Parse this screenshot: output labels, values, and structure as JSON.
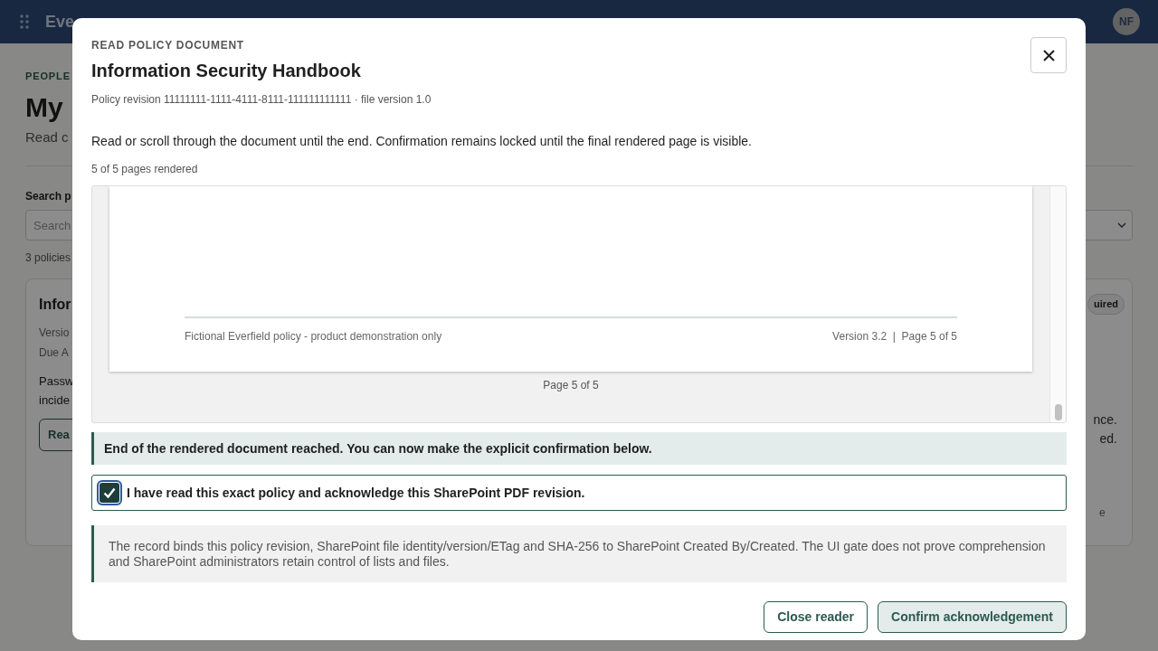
{
  "background": {
    "app_name": "Eve",
    "avatar": "NF",
    "eyebrow": "PEOPLE",
    "heading": "My",
    "subtitle": "Read c",
    "search_label": "Search p",
    "search_placeholder": "Search",
    "count": "3 policies",
    "card": {
      "title": "Infor",
      "badge": "uired",
      "meta": [
        "Versio",
        "Due A"
      ],
      "body": [
        "Passw",
        "incide"
      ],
      "button": "Rea",
      "right_lines": [
        "nce.",
        "ed."
      ],
      "right_footer": "e"
    }
  },
  "dialog": {
    "eyebrow": "READ POLICY DOCUMENT",
    "title": "Information Security Handbook",
    "subtitle": "Policy revision 11111111-1111-4111-8111-111111111111 · file version 1.0",
    "instruction": "Read or scroll through the document until the end. Confirmation remains locked until the final rendered page is visible.",
    "progress": "5 of 5 pages rendered",
    "viewer": {
      "footer_left": "Fictional Everfield policy - product demonstration only",
      "footer_right": "Version 3.2  |  Page 5 of 5",
      "page_label": "Page 5 of 5"
    },
    "notice": "End of the rendered document reached. You can now make the explicit confirmation below.",
    "confirmation": {
      "label": "I have read this exact policy and acknowledge this SharePoint PDF revision.",
      "checked": true
    },
    "info": "The record binds this policy revision, SharePoint file identity/version/ETag and SHA-256 to SharePoint Created By/Created. The UI gate does not prove comprehension and SharePoint administrators retain control of lists and files.",
    "buttons": [
      {
        "label": "Close reader",
        "kind": "secondary"
      },
      {
        "label": "Confirm acknowledgement",
        "kind": "primary"
      }
    ]
  }
}
